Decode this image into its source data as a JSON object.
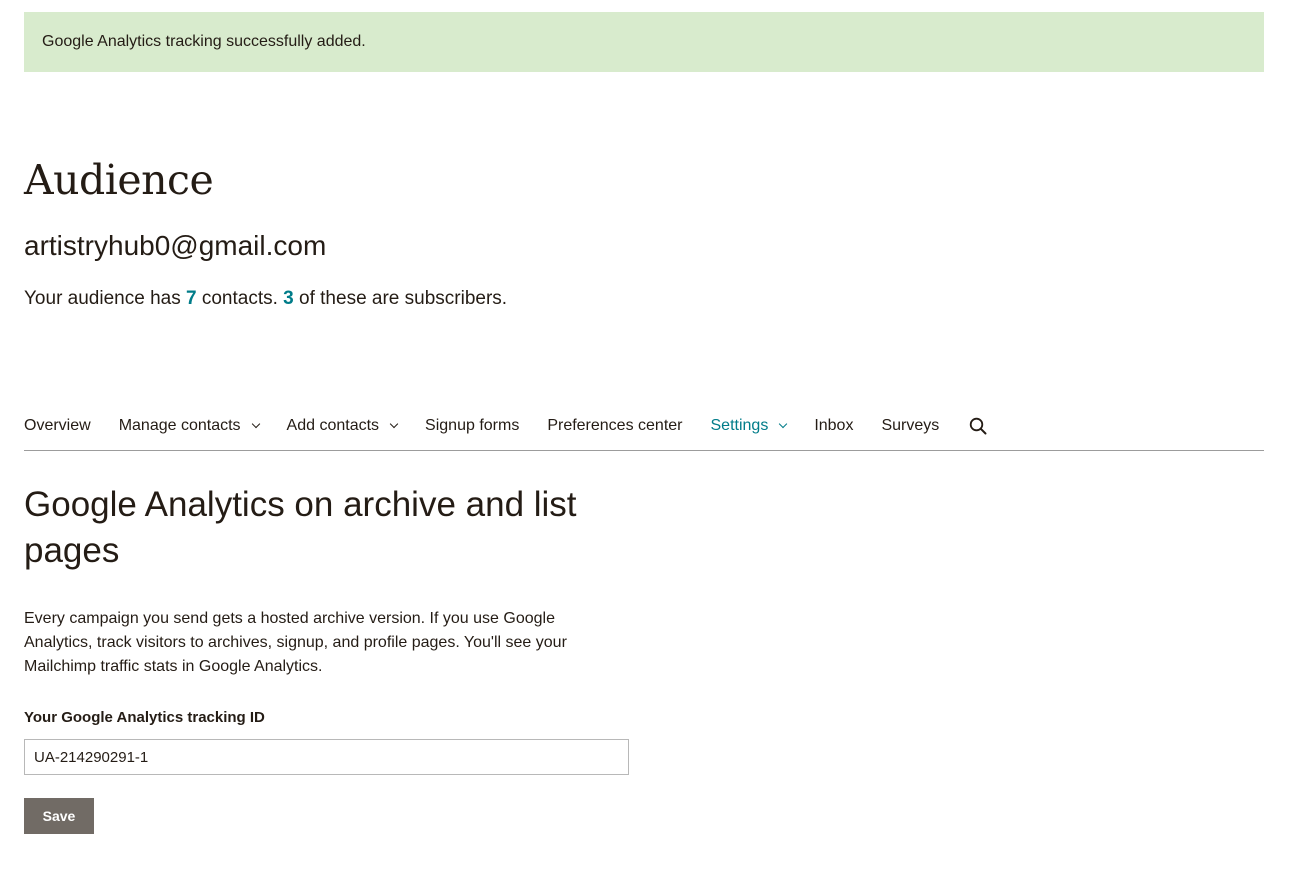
{
  "alert": {
    "message": "Google Analytics tracking successfully added."
  },
  "header": {
    "title": "Audience",
    "audience_name": "artistryhub0@gmail.com",
    "summary": {
      "prefix": "Your audience has ",
      "contacts_count": "7",
      "middle": " contacts. ",
      "subscribers_count": "3",
      "suffix": " of these are subscribers."
    }
  },
  "nav": {
    "items": [
      {
        "label": "Overview",
        "dropdown": false,
        "active": false
      },
      {
        "label": "Manage contacts",
        "dropdown": true,
        "active": false
      },
      {
        "label": "Add contacts",
        "dropdown": true,
        "active": false
      },
      {
        "label": "Signup forms",
        "dropdown": false,
        "active": false
      },
      {
        "label": "Preferences center",
        "dropdown": false,
        "active": false
      },
      {
        "label": "Settings",
        "dropdown": true,
        "active": true
      },
      {
        "label": "Inbox",
        "dropdown": false,
        "active": false
      },
      {
        "label": "Surveys",
        "dropdown": false,
        "active": false
      }
    ],
    "search_icon": "search-icon"
  },
  "main": {
    "title": "Google Analytics on archive and list pages",
    "description": "Every campaign you send gets a hosted archive version. If you use Google Analytics, track visitors to archives, signup, and profile pages. You'll see your Mailchimp traffic stats in Google Analytics.",
    "tracking_label": "Your Google Analytics tracking ID",
    "tracking_value": "UA-214290291-1",
    "save_label": "Save"
  },
  "colors": {
    "alert_bg": "#d8ebcd",
    "accent": "#007c89",
    "button_bg": "#716b65",
    "text": "#241c15"
  }
}
